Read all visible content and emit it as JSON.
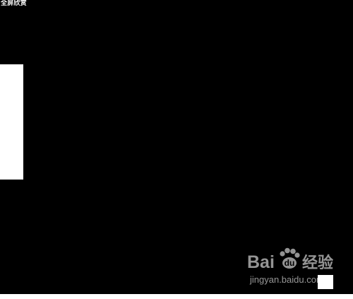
{
  "screen": {
    "mode_label": "全屏欣赏",
    "background_color": "#000000",
    "panel_color": "#ffffff"
  },
  "watermark": {
    "brand_left": "Bai",
    "brand_right": "经验",
    "url": "jingyan.baidu.com",
    "icon": "paw-icon"
  }
}
